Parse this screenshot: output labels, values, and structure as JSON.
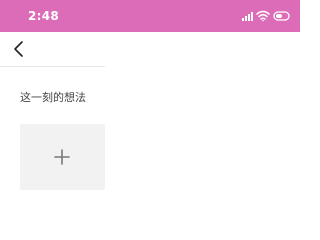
{
  "status_bar": {
    "time": "2:48",
    "background_color": "#dd6cb8",
    "icons": [
      "signal-icon",
      "wifi-icon",
      "battery-icon"
    ]
  },
  "nav": {
    "back_icon": "chevron-left-icon"
  },
  "content": {
    "prompt_label": "这一刻的想法",
    "add_photo_icon": "plus-icon"
  }
}
